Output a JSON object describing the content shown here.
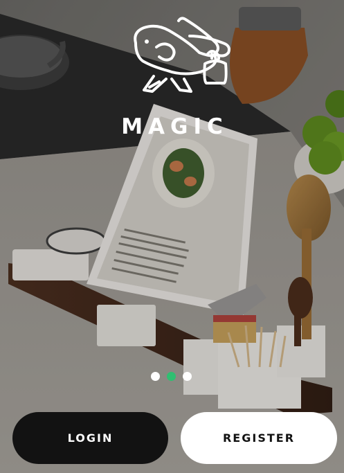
{
  "brand": {
    "name": "MAGIC",
    "logo_icon": "rabbit-with-kettlebell-icon"
  },
  "background": {
    "description_icon": "kitchen-tablet-photo"
  },
  "pager": {
    "count": 3,
    "active_index": 1,
    "active_color": "#2fbf71",
    "inactive_color": "#ffffff"
  },
  "actions": {
    "login_label": "LOGIN",
    "register_label": "REGISTER"
  },
  "colors": {
    "login_bg": "#121212",
    "register_bg": "#ffffff"
  }
}
